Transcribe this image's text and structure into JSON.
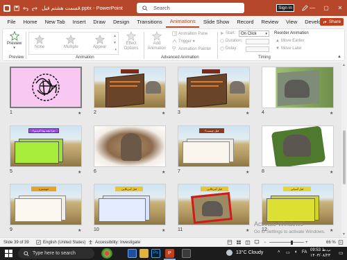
{
  "window": {
    "title": "قسمت هشتم فیل.pptx - PowerPoint",
    "search_placeholder": "Search",
    "signin_label": "Sign in",
    "minimize": "—",
    "maximize": "▢",
    "close": "✕"
  },
  "menu": {
    "tabs": [
      "File",
      "Home",
      "New Tab",
      "Insert",
      "Draw",
      "Design",
      "Transitions",
      "Animations",
      "Slide Show",
      "Record",
      "Review",
      "View",
      "Developer"
    ],
    "active": "Animations",
    "share_label": "Share"
  },
  "ribbon": {
    "preview": {
      "button": "Preview",
      "group": "Preview"
    },
    "animation": {
      "items": [
        "None",
        "Multiple",
        "Appear"
      ],
      "effect_options": "Effect Options",
      "group": "Animation"
    },
    "advanced": {
      "add_animation": "Add Animation",
      "pane": "Animation Pane",
      "trigger": "Trigger",
      "painter": "Animation Painter",
      "group": "Advanced Animation"
    },
    "timing": {
      "start_label": "Start:",
      "start_value": "On Click",
      "duration_label": "Duration:",
      "delay_label": "Delay:",
      "reorder": "Reorder Animation",
      "move_earlier": "Move Earlier",
      "move_later": "Move Later",
      "group": "Timing"
    }
  },
  "slides": [
    {
      "number": "1",
      "title": ""
    },
    {
      "number": "2",
      "title": ""
    },
    {
      "number": "3",
      "title": ""
    },
    {
      "number": "4",
      "title": ""
    },
    {
      "number": "5",
      "title": "چرا بچه پیدا کردیم؟"
    },
    {
      "number": "6",
      "title": ""
    },
    {
      "number": "7",
      "title": "فیل چیست؟"
    },
    {
      "number": "8",
      "title": ""
    },
    {
      "number": "9",
      "title": "خوشمزه"
    },
    {
      "number": "10",
      "title": "فیل آمریکایی"
    },
    {
      "number": "11",
      "title": "فیل آمریکایی"
    },
    {
      "number": "12",
      "title": "فیل آسیایی"
    }
  ],
  "watermark": {
    "line1": "Activate Windows",
    "line2": "Go to Settings to activate Windows."
  },
  "status": {
    "slide": "Slide 39 of 39",
    "language": "English (United States)",
    "accessibility": "Accessibility: Investigate",
    "zoom": "66 %"
  },
  "taskbar": {
    "search_placeholder": "Type here to search",
    "weather": "13°C  Cloudy",
    "lang": "FA",
    "time": "09:53 ب.ظ",
    "date": "۱۴۰۳/۰۸/۲۳"
  },
  "colors": {
    "accent": "#b7472a",
    "share": "#c43e1c",
    "taskbar": "#1c1c1c"
  }
}
